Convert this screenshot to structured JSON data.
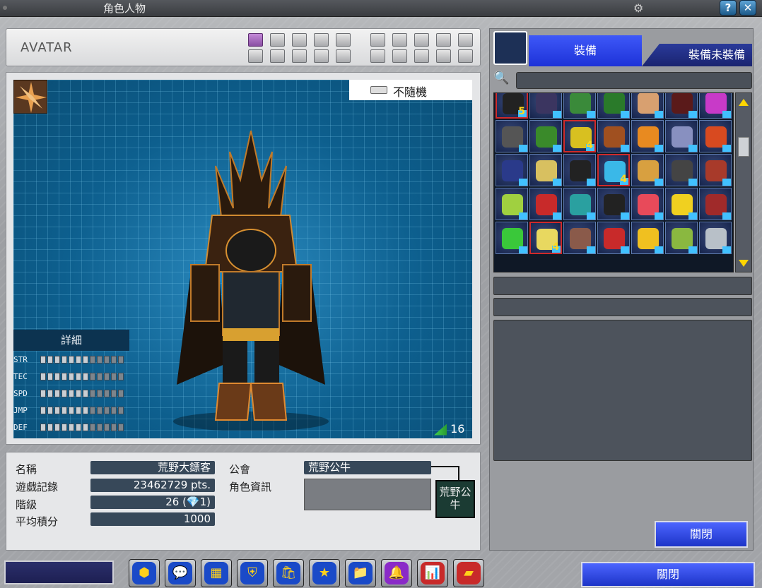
{
  "window": {
    "title": "角色人物"
  },
  "header": {
    "avatar_label": "AVATAR"
  },
  "viewport": {
    "random_label": "不隨機",
    "ping": "16",
    "stats": {
      "title": "詳細",
      "rows": [
        {
          "label": "STR",
          "value": 7
        },
        {
          "label": "TEC",
          "value": 7
        },
        {
          "label": "SPD",
          "value": 7
        },
        {
          "label": "JMP",
          "value": 7
        },
        {
          "label": "DEF",
          "value": 7
        }
      ]
    }
  },
  "profile": {
    "name_label": "名稱",
    "name_value": "荒野大鏢客",
    "record_label": "遊戲記錄",
    "record_value": "23462729 pts.",
    "rank_label": "階級",
    "rank_value": "26 (💎1)",
    "avg_label": "平均積分",
    "avg_value": "1000",
    "guild_label": "公會",
    "guild_value": "荒野公牛",
    "role_label": "角色資訊",
    "emblem_text": "荒野公牛"
  },
  "inventory": {
    "tab_equip": "裝備",
    "tab_unequip": "裝備未裝備",
    "search_placeholder": "",
    "items": [
      {
        "color": "#222",
        "num": "5",
        "sel": true
      },
      {
        "color": "#3b3560"
      },
      {
        "color": "#3a8a3a"
      },
      {
        "color": "#2a7a2a"
      },
      {
        "color": "#d8a070"
      },
      {
        "color": "#5a1a1a"
      },
      {
        "color": "#c83ac8"
      },
      {
        "color": "#555"
      },
      {
        "color": "#3a8a2a"
      },
      {
        "color": "#d8c020",
        "num": "4",
        "sel": true
      },
      {
        "color": "#a05020"
      },
      {
        "color": "#e88a20"
      },
      {
        "color": "#8890c0"
      },
      {
        "color": "#d84a20"
      },
      {
        "color": "#2a3a8a"
      },
      {
        "color": "#d8c060"
      },
      {
        "color": "#222"
      },
      {
        "color": "#3ab8e8",
        "num": "4",
        "sel": true
      },
      {
        "color": "#d8a040"
      },
      {
        "color": "#444"
      },
      {
        "color": "#a83a2a"
      },
      {
        "color": "#a0d040"
      },
      {
        "color": "#c82a2a"
      },
      {
        "color": "#2aa0a0"
      },
      {
        "color": "#222"
      },
      {
        "color": "#e84a5a"
      },
      {
        "color": "#f0d020"
      },
      {
        "color": "#a02a2a"
      },
      {
        "color": "#3ac83a"
      },
      {
        "color": "#e8d860",
        "num": "4",
        "sel": true
      },
      {
        "color": "#8a5a4a"
      },
      {
        "color": "#c82a2a"
      },
      {
        "color": "#f0c020"
      },
      {
        "color": "#8ab840"
      },
      {
        "color": "#b8c0c8"
      }
    ],
    "close_label": "關閉"
  },
  "footer": {
    "close_label": "關閉"
  },
  "toolbar": {
    "buttons": [
      {
        "name": "cube-icon",
        "glyph": "⬢",
        "bg": "#1a4ac8"
      },
      {
        "name": "chat-icon",
        "glyph": "💬",
        "bg": "#1a4ac8"
      },
      {
        "name": "box-icon",
        "glyph": "▦",
        "bg": "#1a4ac8"
      },
      {
        "name": "shield-icon",
        "glyph": "⛨",
        "bg": "#1a4ac8"
      },
      {
        "name": "bag-icon",
        "glyph": "🛍",
        "bg": "#1a4ac8"
      },
      {
        "name": "star-icon",
        "glyph": "★",
        "bg": "#1a4ac8"
      },
      {
        "name": "folder-icon",
        "glyph": "📁",
        "bg": "#1a4ac8"
      },
      {
        "name": "bell-icon",
        "glyph": "🔔",
        "bg": "#8a2ac8"
      },
      {
        "name": "chart-icon",
        "glyph": "📊",
        "bg": "#c82a2a"
      },
      {
        "name": "card-icon",
        "glyph": "▰",
        "bg": "#c82a2a"
      }
    ]
  }
}
